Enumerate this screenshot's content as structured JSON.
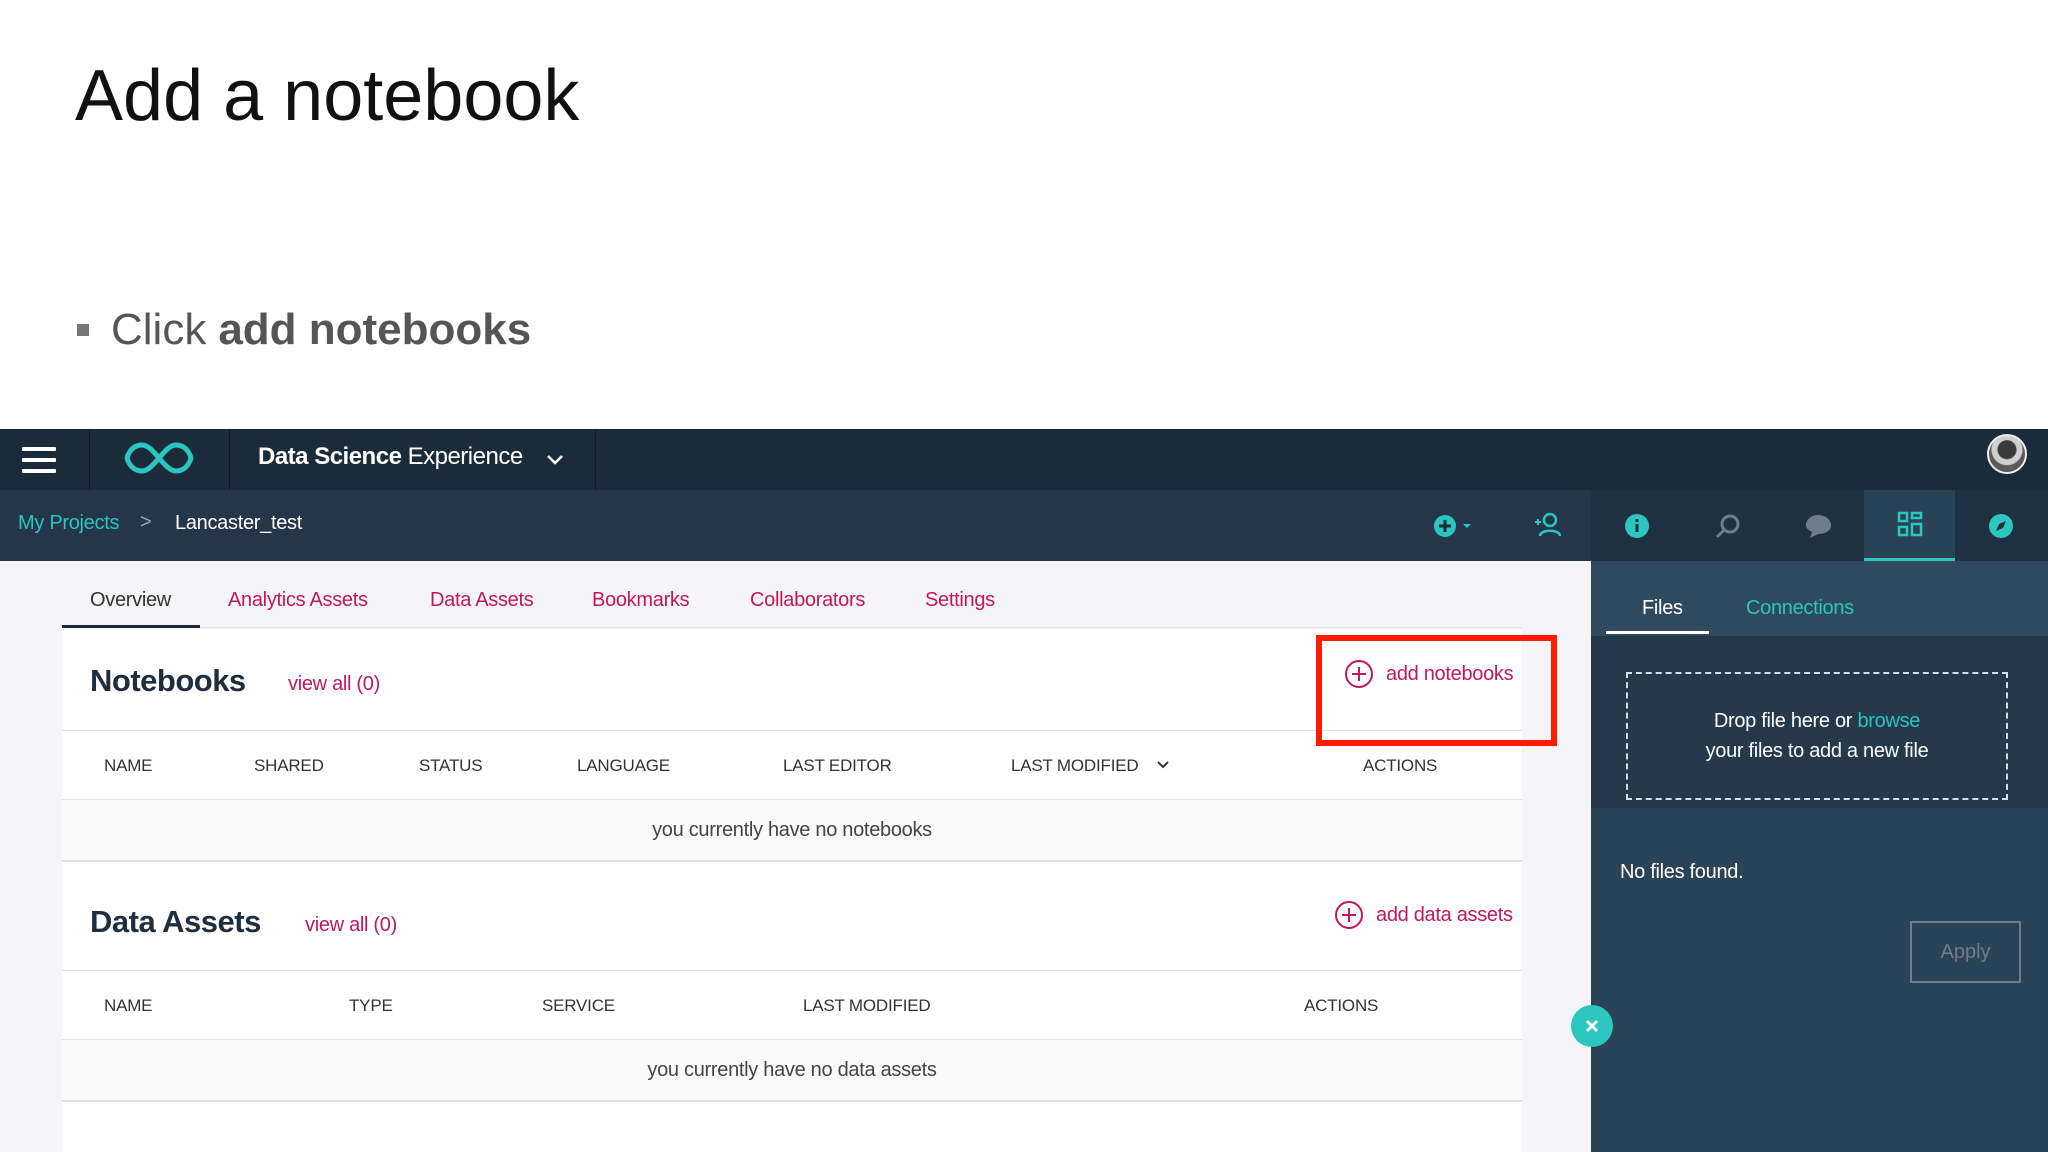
{
  "slide": {
    "title": "Add a notebook",
    "bullet_prefix": "Click",
    "bullet_bold": "add notebooks"
  },
  "topbar": {
    "app_title_bold": "Data Science",
    "app_title_rest": "Experience",
    "icons": [
      "menu-icon",
      "infinity-logo",
      "chevron-down-icon",
      "avatar"
    ]
  },
  "breadcrumb": {
    "root": "My Projects",
    "separator": ">",
    "current": "Lancaster_test"
  },
  "project_tabs": [
    {
      "label": "Overview",
      "active": true
    },
    {
      "label": "Analytics Assets"
    },
    {
      "label": "Data Assets"
    },
    {
      "label": "Bookmarks"
    },
    {
      "label": "Collaborators"
    },
    {
      "label": "Settings"
    }
  ],
  "notebooks": {
    "title": "Notebooks",
    "view_all": "view all (0)",
    "add_label": "add notebooks",
    "columns": [
      "NAME",
      "SHARED",
      "STATUS",
      "LANGUAGE",
      "LAST EDITOR",
      "LAST MODIFIED",
      "ACTIONS"
    ],
    "empty_text": "you currently have no notebooks"
  },
  "data_assets": {
    "title": "Data Assets",
    "view_all": "view all (0)",
    "add_label": "add data assets",
    "columns": [
      "NAME",
      "TYPE",
      "SERVICE",
      "LAST MODIFIED",
      "ACTIONS"
    ],
    "empty_text": "you currently have no data assets"
  },
  "right_panel": {
    "tabs": [
      "Files",
      "Connections"
    ],
    "drop_text_1": "Drop file here or",
    "browse_link": "browse",
    "drop_text_2": "your files to add a new file",
    "no_files": "No files found.",
    "apply_label": "Apply"
  },
  "colors": {
    "accent_teal": "#29c5c0",
    "link_magenta": "#c2185b",
    "nav_dark": "#1c2b3a",
    "highlight_red": "#ff1a00"
  }
}
